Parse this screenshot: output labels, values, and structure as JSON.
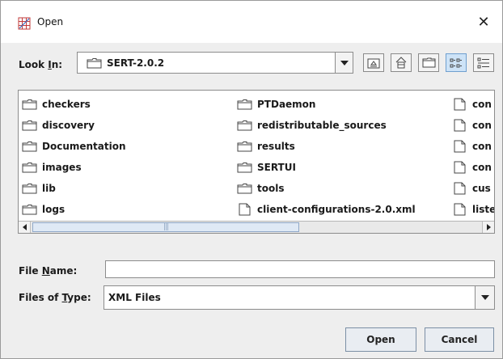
{
  "window": {
    "title": "Open",
    "close_glyph": "✕"
  },
  "lookin": {
    "label_prefix": "Look ",
    "label_mnemonic": "I",
    "label_suffix": "n:",
    "value": "SERT-2.0.2"
  },
  "toolbar": {
    "buttons": [
      "up-one-level",
      "home",
      "new-folder",
      "list-view",
      "details-view"
    ],
    "active": "list-view"
  },
  "files": {
    "columns": [
      [
        {
          "name": "checkers",
          "type": "folder"
        },
        {
          "name": "discovery",
          "type": "folder"
        },
        {
          "name": "Documentation",
          "type": "folder"
        },
        {
          "name": "images",
          "type": "folder"
        },
        {
          "name": "lib",
          "type": "folder"
        },
        {
          "name": "logs",
          "type": "folder"
        }
      ],
      [
        {
          "name": "PTDaemon",
          "type": "folder"
        },
        {
          "name": "redistributable_sources",
          "type": "folder"
        },
        {
          "name": "results",
          "type": "folder"
        },
        {
          "name": "SERTUI",
          "type": "folder"
        },
        {
          "name": "tools",
          "type": "folder"
        },
        {
          "name": "client-configurations-2.0.xml",
          "type": "file"
        }
      ],
      [
        {
          "name": "con",
          "type": "file"
        },
        {
          "name": "con",
          "type": "file"
        },
        {
          "name": "con",
          "type": "file"
        },
        {
          "name": "con",
          "type": "file"
        },
        {
          "name": "cus",
          "type": "file"
        },
        {
          "name": "liste",
          "type": "file"
        }
      ]
    ]
  },
  "file_name": {
    "label_prefix": "File ",
    "label_mnemonic": "N",
    "label_suffix": "ame:",
    "value": ""
  },
  "file_type": {
    "label_prefix": "Files of ",
    "label_mnemonic": "T",
    "label_suffix": "ype:",
    "value": "XML Files"
  },
  "buttons": {
    "open": "Open",
    "cancel": "Cancel"
  },
  "colors": {
    "selected_toolbar": "#cde3f7",
    "scroll_thumb": "#dfe9f5"
  }
}
